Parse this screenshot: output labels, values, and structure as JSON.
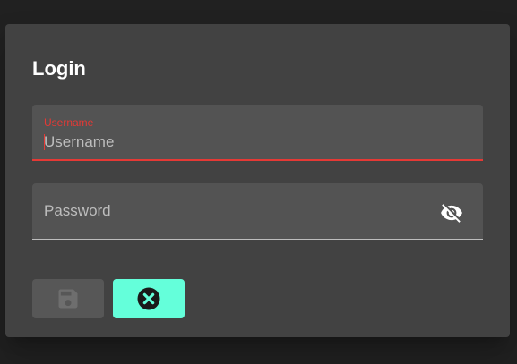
{
  "dialog": {
    "title": "Login",
    "username": {
      "floating_label": "Username",
      "placeholder": "Username",
      "value": ""
    },
    "password": {
      "placeholder": "Password",
      "value": "",
      "toggle_icon": "eye-off-icon"
    },
    "buttons": {
      "save_icon": "floppy-disk-icon",
      "cancel_icon": "close-circle-icon"
    }
  },
  "colors": {
    "background": "#212121",
    "dialog": "#424242",
    "field": "#535353",
    "error": "#e53935",
    "accent": "#64ffda",
    "disabled_button": "#575757"
  }
}
